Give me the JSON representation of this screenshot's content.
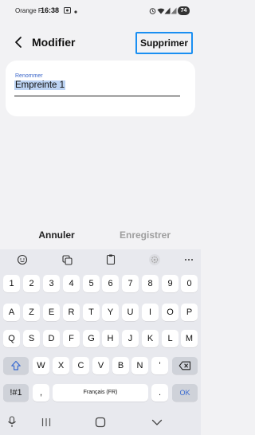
{
  "status_bar": {
    "carrier": "Orange F",
    "time": "16:38",
    "battery": "74",
    "icons": [
      "screenshot-icon",
      "dot-icon",
      "alarm-icon",
      "wifi-icon",
      "signal-icon",
      "signal-icon-2",
      "battery-icon"
    ]
  },
  "header": {
    "title": "Modifier",
    "delete_label": "Supprimer"
  },
  "rename": {
    "label": "Renommer",
    "value": "Empreinte 1"
  },
  "actions": {
    "cancel_label": "Annuler",
    "save_label": "Enregistrer"
  },
  "keyboard": {
    "toolbar_icons": [
      "emoji-icon",
      "sticker-icon",
      "clipboard-icon",
      "settings-icon",
      "more-icon"
    ],
    "rows": [
      [
        "1",
        "2",
        "3",
        "4",
        "5",
        "6",
        "7",
        "8",
        "9",
        "0"
      ],
      [
        "A",
        "Z",
        "E",
        "R",
        "T",
        "Y",
        "U",
        "I",
        "O",
        "P"
      ],
      [
        "Q",
        "S",
        "D",
        "F",
        "G",
        "H",
        "J",
        "K",
        "L",
        "M"
      ],
      [
        "W",
        "X",
        "C",
        "V",
        "B",
        "N",
        "'"
      ]
    ],
    "symbols_label": "!#1",
    "comma_label": ",",
    "language_label": "Français (FR)",
    "period_label": ".",
    "ok_label": "OK",
    "accent_color": "#3a6bd1"
  },
  "nav_bar": {
    "icons": [
      "keyboard-hide-icon",
      "recents-icon",
      "home-icon",
      "back-chevron-icon"
    ]
  }
}
